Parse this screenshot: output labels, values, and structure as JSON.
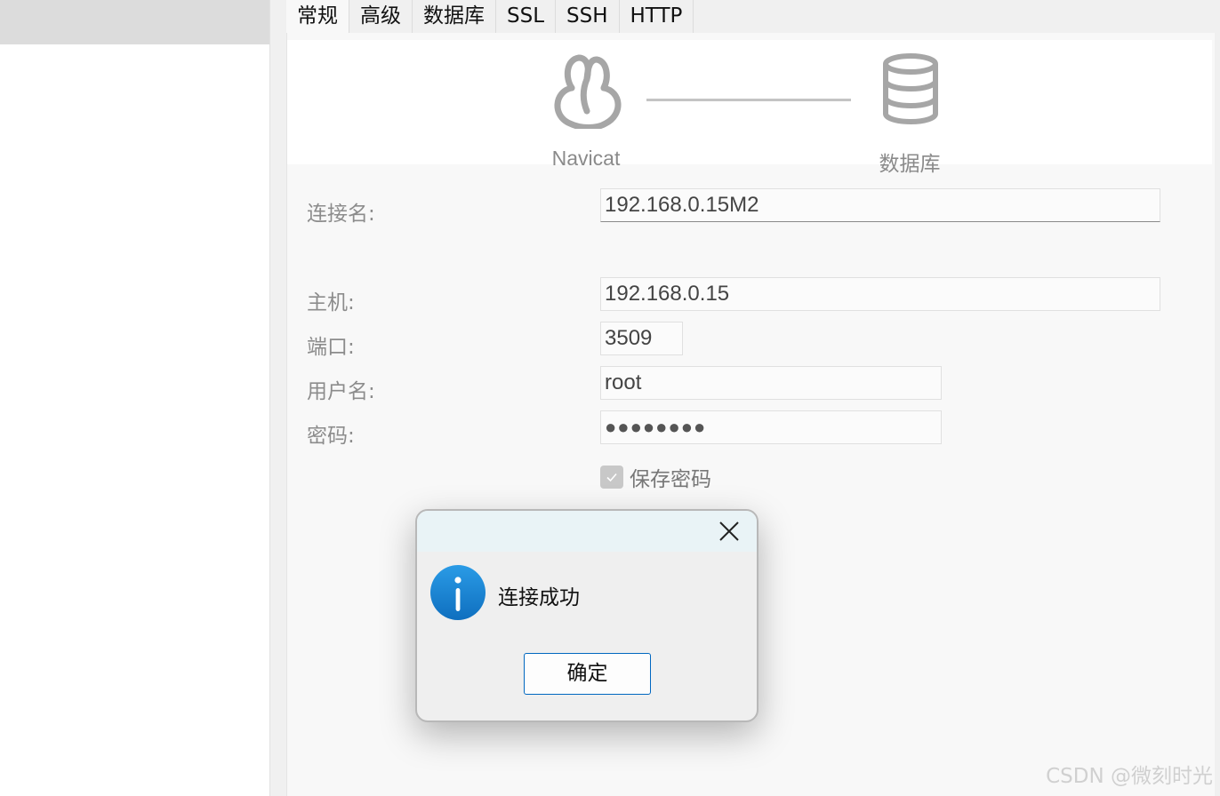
{
  "tabs": [
    {
      "label": "常规",
      "active": true
    },
    {
      "label": "高级"
    },
    {
      "label": "数据库"
    },
    {
      "label": "SSL"
    },
    {
      "label": "SSH"
    },
    {
      "label": "HTTP"
    }
  ],
  "banner": {
    "left_label": "Navicat",
    "right_label": "数据库",
    "left_icon": "navicat-logo-icon",
    "right_icon": "database-icon"
  },
  "form": {
    "connection_name": {
      "label": "连接名:",
      "value": "192.168.0.15M2"
    },
    "host": {
      "label": "主机:",
      "value": "192.168.0.15"
    },
    "port": {
      "label": "端口:",
      "value": "3509"
    },
    "username": {
      "label": "用户名:",
      "value": "root"
    },
    "password": {
      "label": "密码:",
      "value": "●●●●●●●●"
    },
    "save_password": {
      "label": "保存密码",
      "checked": true
    }
  },
  "dialog": {
    "message": "连接成功",
    "ok_label": "确定",
    "icon": "info-icon",
    "close_icon": "close-icon"
  },
  "watermark": "CSDN @微刻时光",
  "colors": {
    "accent": "#0067c0",
    "info_icon": "#1a8ad4"
  }
}
